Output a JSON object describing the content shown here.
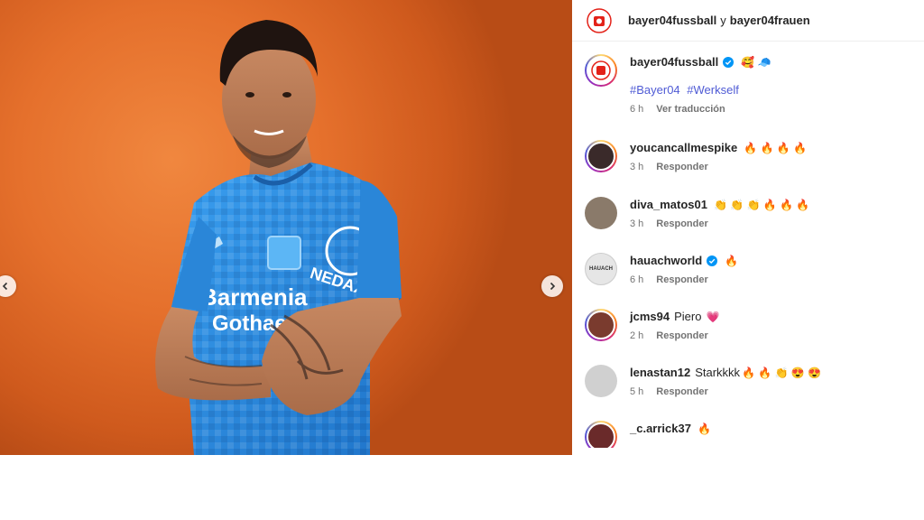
{
  "header": {
    "account_1": "bayer04fussball",
    "joiner": "y",
    "account_2": "bayer04frauen"
  },
  "caption": {
    "username": "bayer04fussball",
    "emojis": "🥰 🧢",
    "hashtags": [
      "#Bayer04",
      "#Werkself"
    ],
    "time": "6 h",
    "translate_label": "Ver traducción"
  },
  "comments": [
    {
      "username": "youcancallmespike",
      "text": "",
      "emojis": "🔥 🔥 🔥 🔥",
      "time": "3 h",
      "reply_label": "Responder",
      "avatar_color": "#3a2a2a"
    },
    {
      "username": "diva_matos01",
      "text": "",
      "emojis": "👏 👏 👏 🔥 🔥 🔥",
      "time": "3 h",
      "reply_label": "Responder",
      "avatar_color": "#8a7a6a"
    },
    {
      "username": "hauachworld",
      "text": "",
      "emojis": "🔥",
      "time": "6 h",
      "reply_label": "Responder",
      "avatar_color": "#d9d9d9",
      "verified": true,
      "avatar_text": "HAUACH"
    },
    {
      "username": "jcms94",
      "text": "Piero",
      "emojis": "💗",
      "time": "2 h",
      "reply_label": "Responder",
      "avatar_color": "#7a3b2e"
    },
    {
      "username": "lenastan12",
      "text": "Starkkkk",
      "emojis": "🔥 🔥 👏 😍 😍",
      "time": "5 h",
      "reply_label": "Responder",
      "avatar_color": "#cfcfcf"
    },
    {
      "username": "_c.arrick37",
      "text": "",
      "emojis": "🔥",
      "time": "",
      "reply_label": "",
      "avatar_color": "#6a2a2a"
    }
  ],
  "photo": {
    "jersey_sponsor_1": "Barmenia",
    "jersey_sponsor_2": "Gothaer",
    "sleeve_text": "NEDAX"
  },
  "colors": {
    "background_orange": "#e5702c",
    "jersey_blue": "#2f8fe0",
    "hashtag": "#4f5bd5",
    "verified": "#0095f6"
  }
}
